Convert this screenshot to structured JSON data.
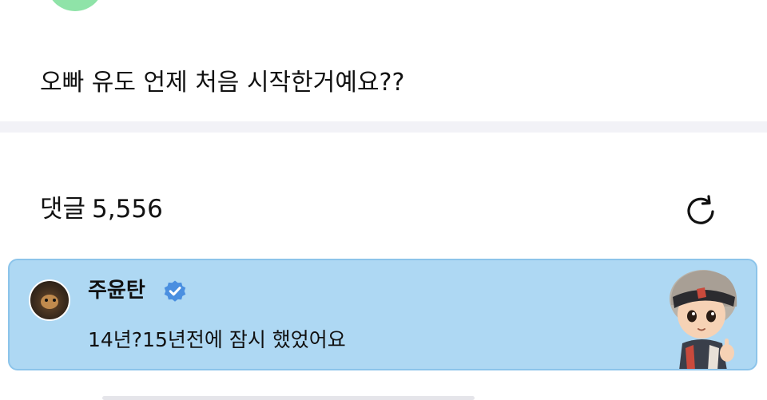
{
  "post": {
    "text": "오빠 유도 언제 처음 시작한거예요??"
  },
  "comments": {
    "label": "댓글",
    "count": "5,556",
    "refresh_icon": "refresh-icon"
  },
  "comment": {
    "author": "주윤탄",
    "verified_icon": "verified-badge-icon",
    "text": "14년?15년전에 잠시 했었어요",
    "card_color": "#aed8f3",
    "badge_color": "#4a8fe0"
  }
}
